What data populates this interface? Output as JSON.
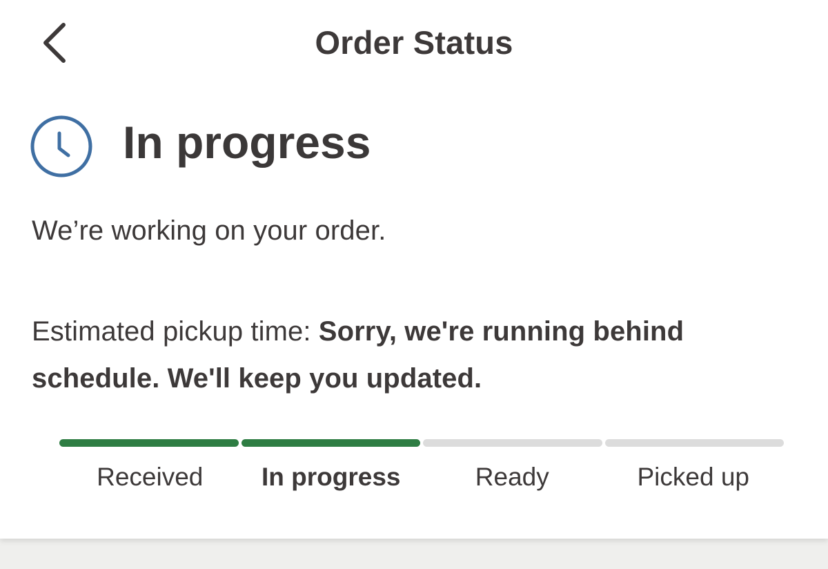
{
  "header": {
    "back_icon": "chevron-left-icon",
    "title": "Order Status"
  },
  "status": {
    "icon": "clock-icon",
    "icon_color": "#3f6fa3",
    "title": "In progress",
    "message": "We’re working on your order."
  },
  "pickup": {
    "label": "Estimated pickup time: ",
    "value": "Sorry, we're running behind schedule. We'll keep you updated."
  },
  "progress": {
    "completed_color": "#2e7d43",
    "pending_color": "#dcdcdc",
    "completed_steps": 2,
    "current_step": "In progress",
    "steps": [
      {
        "label": "Received"
      },
      {
        "label": "In progress"
      },
      {
        "label": "Ready"
      },
      {
        "label": "Picked up"
      }
    ]
  }
}
